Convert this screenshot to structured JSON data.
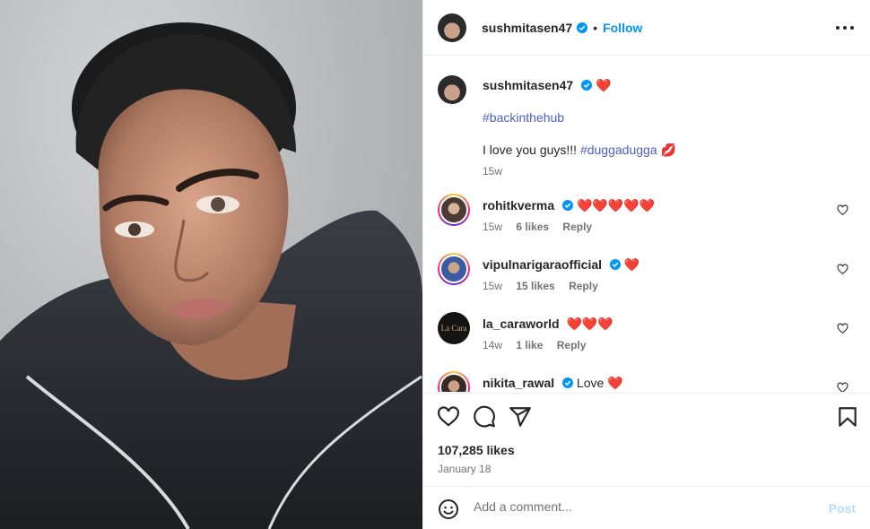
{
  "post": {
    "author": "sushmitasen47",
    "follow_label": "Follow",
    "separator": "•",
    "caption_heart": "❤️",
    "caption_tag": "#backinthehub",
    "caption_line": "I love you guys!!!",
    "caption_tag2": "#duggadugga",
    "caption_emoji": "💋",
    "caption_time": "15w",
    "likes": "107,285 likes",
    "date": "January 18"
  },
  "comments": [
    {
      "user": "rohitkverma",
      "verified": true,
      "text": "❤️❤️❤️❤️❤️",
      "time": "15w",
      "likes": "6 likes",
      "reply": "Reply"
    },
    {
      "user": "vipulnarigaraofficial",
      "verified": true,
      "text": "❤️",
      "time": "15w",
      "likes": "15 likes",
      "reply": "Reply"
    },
    {
      "user": "la_caraworld",
      "verified": false,
      "text": "❤️❤️❤️",
      "time": "14w",
      "likes": "1 like",
      "reply": "Reply"
    },
    {
      "user": "nikita_rawal",
      "verified": true,
      "text": "Love ❤️",
      "time": "",
      "likes": "",
      "reply": ""
    }
  ],
  "la_cara_logo": "La Cara",
  "composer": {
    "placeholder": "Add a comment...",
    "post_label": "Post"
  },
  "colors": {
    "accent": "#0095f6",
    "verified": "#0095f6",
    "tag": "#4a5fc1",
    "heart": "#ed4956"
  },
  "icons": [
    "heart-icon",
    "comment-icon",
    "share-icon",
    "bookmark-icon",
    "more-icon",
    "emoji-icon",
    "verified-icon"
  ]
}
